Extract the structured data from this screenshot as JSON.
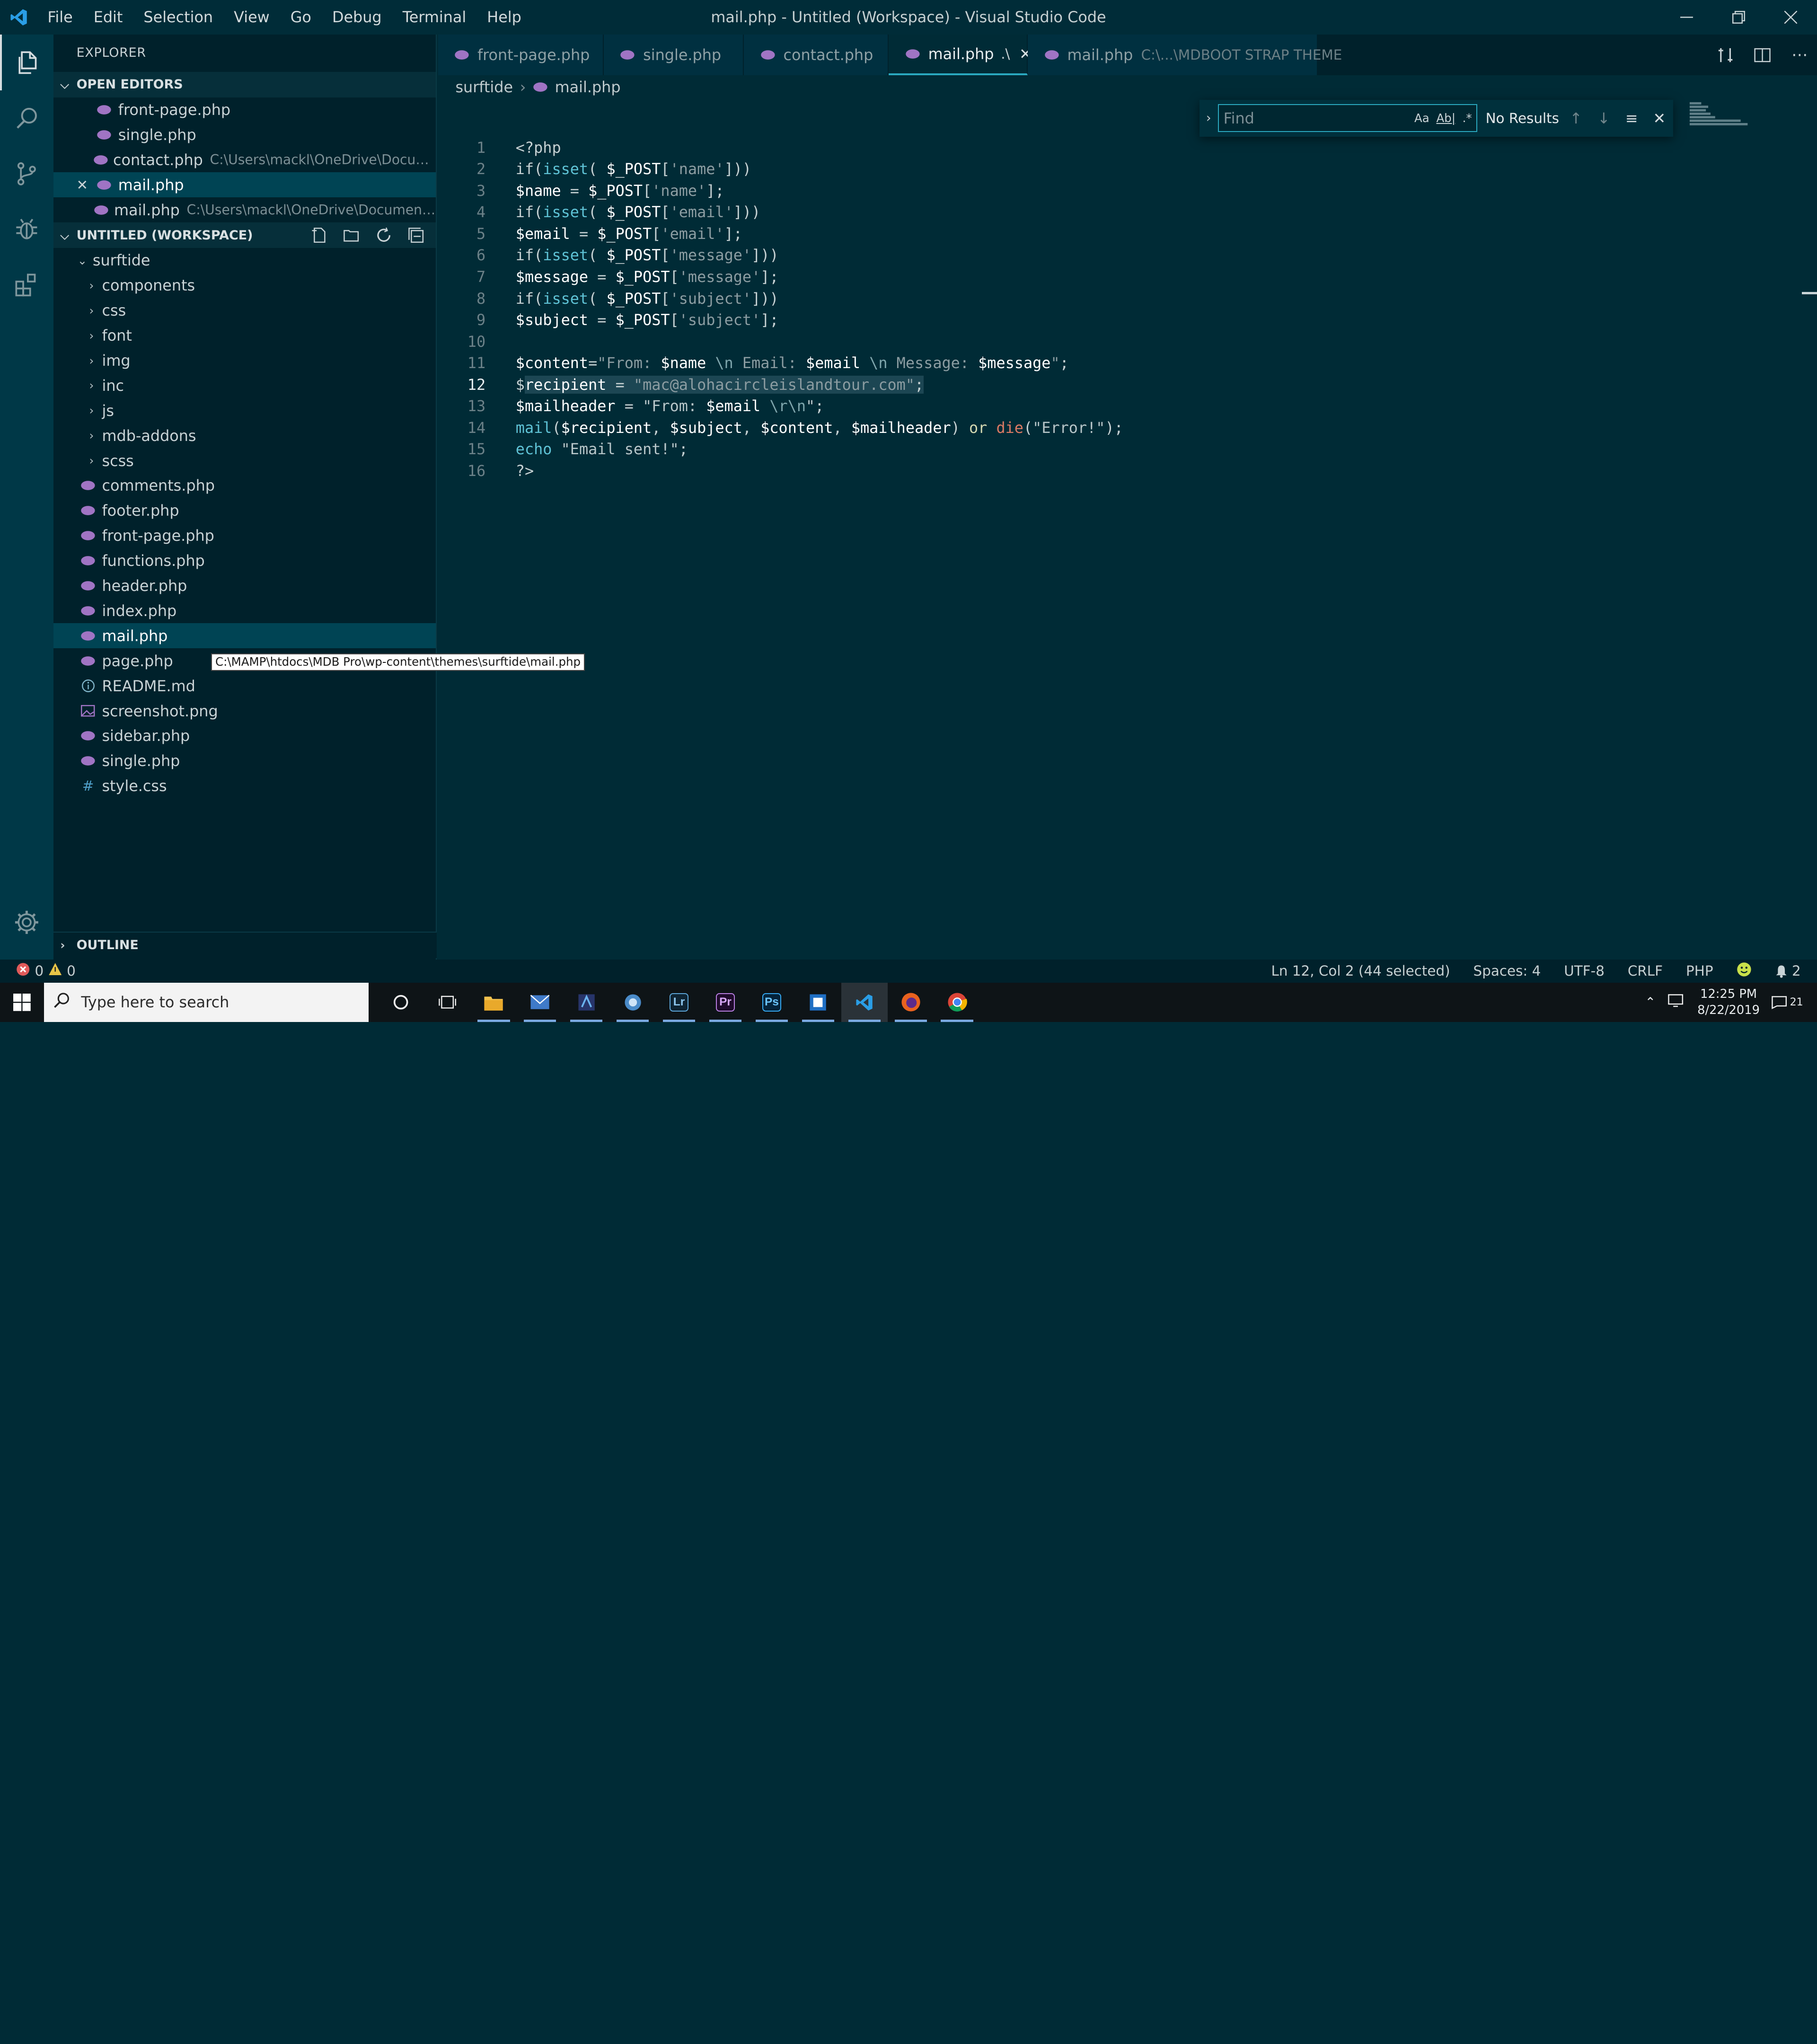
{
  "window": {
    "title": "mail.php - Untitled (Workspace) - Visual Studio Code",
    "menu": [
      "File",
      "Edit",
      "Selection",
      "View",
      "Go",
      "Debug",
      "Terminal",
      "Help"
    ]
  },
  "explorer": {
    "title": "EXPLORER",
    "open_editors_label": "OPEN EDITORS",
    "open_editors": [
      {
        "name": "front-page.php",
        "path": ""
      },
      {
        "name": "single.php",
        "path": ""
      },
      {
        "name": "contact.php",
        "path": "C:\\Users\\mackl\\OneDrive\\Documents\\..."
      },
      {
        "name": "mail.php",
        "path": ""
      },
      {
        "name": "mail.php",
        "path": "C:\\Users\\mackl\\OneDrive\\Documents\\De..."
      }
    ],
    "workspace_label": "UNTITLED (WORKSPACE)",
    "root_folder": "surftide",
    "folders": [
      "components",
      "css",
      "font",
      "img",
      "inc",
      "js",
      "mdb-addons",
      "scss"
    ],
    "files": [
      {
        "name": "comments.php",
        "type": "php"
      },
      {
        "name": "footer.php",
        "type": "php"
      },
      {
        "name": "front-page.php",
        "type": "php"
      },
      {
        "name": "functions.php",
        "type": "php"
      },
      {
        "name": "header.php",
        "type": "php"
      },
      {
        "name": "index.php",
        "type": "php"
      },
      {
        "name": "mail.php",
        "type": "php"
      },
      {
        "name": "page.php",
        "type": "php"
      },
      {
        "name": "README.md",
        "type": "info"
      },
      {
        "name": "screenshot.png",
        "type": "image"
      },
      {
        "name": "sidebar.php",
        "type": "php"
      },
      {
        "name": "single.php",
        "type": "php"
      },
      {
        "name": "style.css",
        "type": "css"
      }
    ],
    "outline_label": "OUTLINE",
    "tooltip": "C:\\MAMP\\htdocs\\MDB Pro\\wp-content\\themes\\surftide\\mail.php"
  },
  "tabs": [
    {
      "label": "front-page.php",
      "path": ""
    },
    {
      "label": "single.php",
      "path": ""
    },
    {
      "label": "contact.php",
      "path": ""
    },
    {
      "label": "mail.php",
      "path": "",
      "suffix": ".\\"
    },
    {
      "label": "mail.php",
      "path": "C:\\...\\MDBOOT STRAP THEME"
    }
  ],
  "breadcrumb": [
    "surftide",
    "mail.php"
  ],
  "find": {
    "placeholder": "Find",
    "match_case": "Aa",
    "whole_word": "Ab|",
    "regex": ".*",
    "result": "No Results"
  },
  "code": {
    "line_numbers": [
      "1",
      "2",
      "3",
      "4",
      "5",
      "6",
      "7",
      "8",
      "9",
      "10",
      "11",
      "12",
      "13",
      "14",
      "15",
      "16"
    ],
    "current_line": 12
  },
  "status": {
    "errors": "0",
    "warnings": "0",
    "position": "Ln 12, Col 2 (44 selected)",
    "spaces": "Spaces: 4",
    "encoding": "UTF-8",
    "eol": "CRLF",
    "language": "PHP",
    "notifications": "2"
  },
  "taskbar": {
    "search_placeholder": "Type here to search",
    "time": "12:25 PM",
    "date": "8/22/2019",
    "notification_count": "21"
  },
  "colors": {
    "accent": "#2aa8bf",
    "php_icon": "#a074c4",
    "background": "#002b36"
  }
}
